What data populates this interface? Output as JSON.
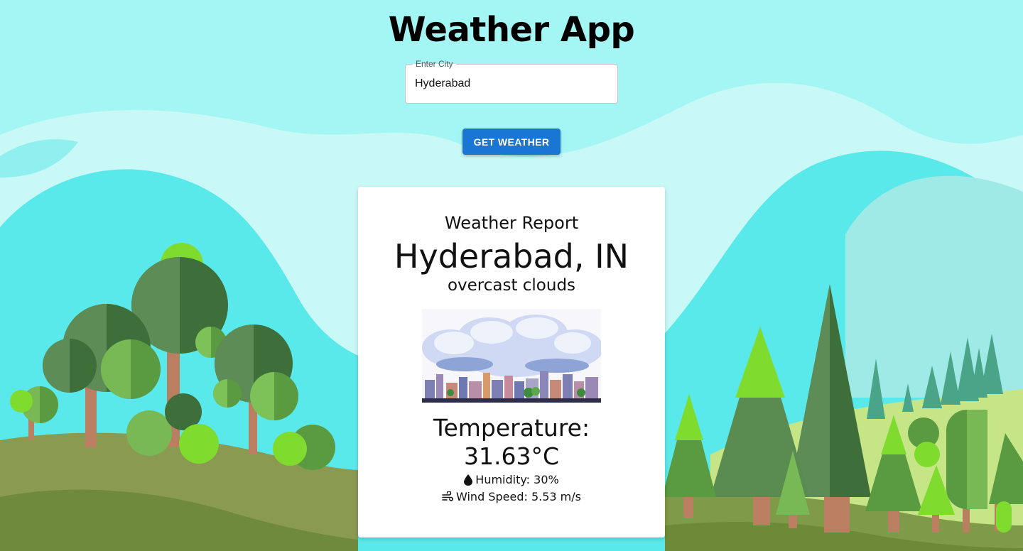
{
  "header": {
    "title": "Weather App"
  },
  "search": {
    "label": "Enter City",
    "value": "Hyderabad"
  },
  "actions": {
    "get_weather_label": "GET WEATHER"
  },
  "report": {
    "heading": "Weather Report",
    "location": "Hyderabad, IN",
    "description": "overcast clouds",
    "temperature_label": "Temperature:",
    "temperature_value": "31.63°C",
    "humidity_text": "Humidity: 30%",
    "wind_text": "Wind Speed: 5.53 m/s",
    "image_icon": "overcast-clouds-cityscape"
  },
  "icons": {
    "humidity": "droplet-icon",
    "wind": "wind-icon"
  },
  "colors": {
    "sky": "#9ef4f2",
    "button": "#1976d2",
    "card": "#ffffff"
  }
}
